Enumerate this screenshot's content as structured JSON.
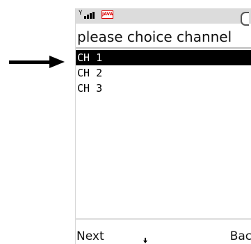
{
  "screen": {
    "title": "please choice channel",
    "java_badge": "JAVA"
  },
  "channels": [
    {
      "label": "CH 1",
      "selected": true
    },
    {
      "label": "CH 2",
      "selected": false
    },
    {
      "label": "CH 3",
      "selected": false
    }
  ],
  "softkeys": {
    "left_label": "Next",
    "right_label": "Back"
  },
  "icons": {
    "pointer": "right-arrow-icon",
    "signal": "signal-strength-icon",
    "java": "java-icon",
    "battery": "battery-icon",
    "nav": "down-arrow-icon"
  }
}
